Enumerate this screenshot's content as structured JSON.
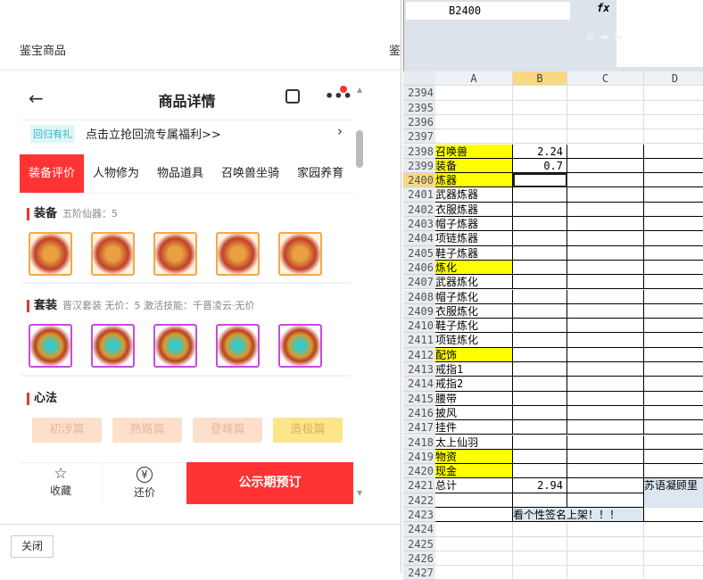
{
  "left": {
    "title": "鉴宝商品",
    "title2": "鉴",
    "close": "关闭"
  },
  "phone": {
    "back": "←",
    "title": "商品详情",
    "more": "•••",
    "banner": {
      "tag": "回归有礼",
      "text": "点击立抢回流专属福利>>",
      "arrow": "›"
    },
    "tabs": [
      "装备评价",
      "人物修为",
      "物品道具",
      "召唤兽坐骑",
      "家园养育"
    ],
    "equip": {
      "title": "装备",
      "sub": "五阶仙器：5"
    },
    "suit": {
      "title": "套装",
      "sub": "晋汉套装   无价：5   激活技能：千晋凌云·无价"
    },
    "xinfa": {
      "title": "心法",
      "items": [
        "初涉篇",
        "熟路篇",
        "登峰篇",
        "造极篇"
      ]
    },
    "footer": {
      "fav": "收藏",
      "fav_icon": "☆",
      "bargain": "还价",
      "bargain_icon": "¥",
      "buy": "公示期预订"
    }
  },
  "excel": {
    "namebox": "B2400",
    "fx": "fx",
    "watermark": "◎ 西瓜视频",
    "columns": [
      "A",
      "B",
      "C",
      "D"
    ],
    "rows": [
      {
        "n": "2394"
      },
      {
        "n": "2395"
      },
      {
        "n": "2396"
      },
      {
        "n": "2397"
      },
      {
        "n": "2398",
        "a": "召唤兽",
        "b": "2.24",
        "y": true
      },
      {
        "n": "2399",
        "a": "装备",
        "b": "0.7",
        "y": true
      },
      {
        "n": "2400",
        "a": "炼器",
        "y": true,
        "sel": true
      },
      {
        "n": "2401",
        "a": "武器炼器"
      },
      {
        "n": "2402",
        "a": "衣服炼器"
      },
      {
        "n": "2403",
        "a": "帽子炼器"
      },
      {
        "n": "2404",
        "a": "项链炼器"
      },
      {
        "n": "2405",
        "a": "鞋子炼器"
      },
      {
        "n": "2406",
        "a": "炼化",
        "y": true
      },
      {
        "n": "2407",
        "a": "武器炼化"
      },
      {
        "n": "2408",
        "a": "帽子炼化"
      },
      {
        "n": "2409",
        "a": "衣服炼化"
      },
      {
        "n": "2410",
        "a": "鞋子炼化"
      },
      {
        "n": "2411",
        "a": "项链炼化"
      },
      {
        "n": "2412",
        "a": "配饰",
        "y": true
      },
      {
        "n": "2413",
        "a": "戒指1"
      },
      {
        "n": "2414",
        "a": "戒指2"
      },
      {
        "n": "2415",
        "a": "腰带"
      },
      {
        "n": "2416",
        "a": "披风"
      },
      {
        "n": "2417",
        "a": "挂件"
      },
      {
        "n": "2418",
        "a": "太上仙羽"
      },
      {
        "n": "2419",
        "a": "物资",
        "y": true
      },
      {
        "n": "2420",
        "a": "现金",
        "y": true
      },
      {
        "n": "2421",
        "a": "总计",
        "b": "2.94",
        "d": "苏语凝顾里"
      },
      {
        "n": "2422"
      },
      {
        "n": "2423",
        "b": "看个性签名上架！！！"
      },
      {
        "n": "2424"
      },
      {
        "n": "2425"
      },
      {
        "n": "2426"
      },
      {
        "n": "2427"
      }
    ]
  }
}
